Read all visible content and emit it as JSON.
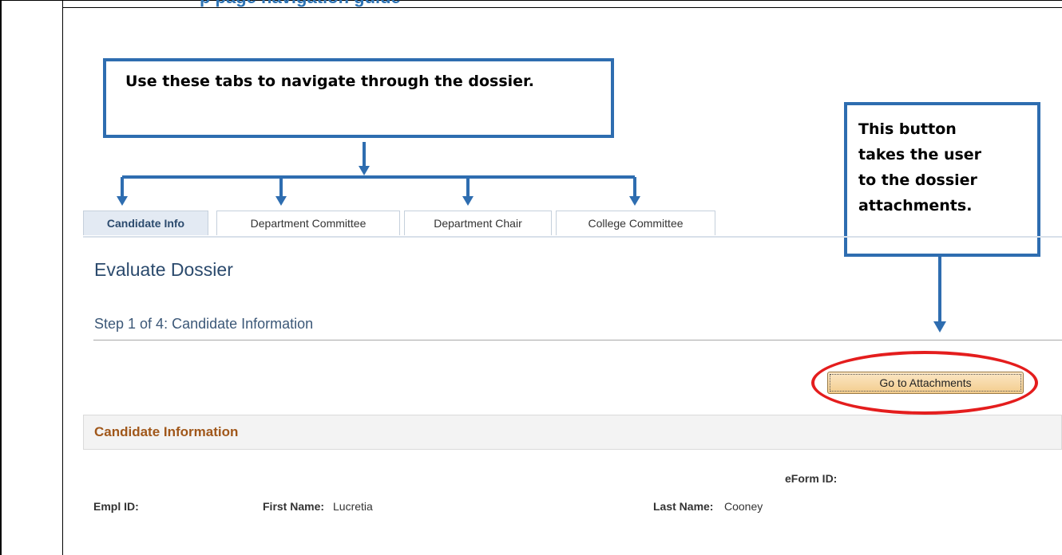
{
  "document": {
    "header_fragment": "p      page navigation guide"
  },
  "callouts": {
    "tabs_note": "Use these tabs to navigate through the dossier.",
    "button_note_lines": [
      "This button",
      "takes the user",
      "to the dossier",
      "attachments."
    ]
  },
  "tabs": [
    {
      "label": "Candidate Info",
      "active": true
    },
    {
      "label": "Department Committee",
      "active": false
    },
    {
      "label": "Department Chair",
      "active": false
    },
    {
      "label": "College Committee",
      "active": false
    }
  ],
  "page": {
    "title": "Evaluate Dossier",
    "step": "Step 1 of 4: Candidate Information",
    "go_button": "Go to Attachments"
  },
  "section": {
    "title": "Candidate Information",
    "fields": {
      "eform_label": "eForm ID:",
      "eform_value": "",
      "empl_label": "Empl ID:",
      "empl_value": "",
      "first_label": "First Name:",
      "first_value": "Lucretia",
      "last_label": "Last Name:",
      "last_value": "Cooney"
    }
  },
  "colors": {
    "callout_border": "#2e6db0",
    "highlight_ellipse": "#e41d1d",
    "section_title": "#a0571a",
    "page_title": "#2b4a6d"
  }
}
